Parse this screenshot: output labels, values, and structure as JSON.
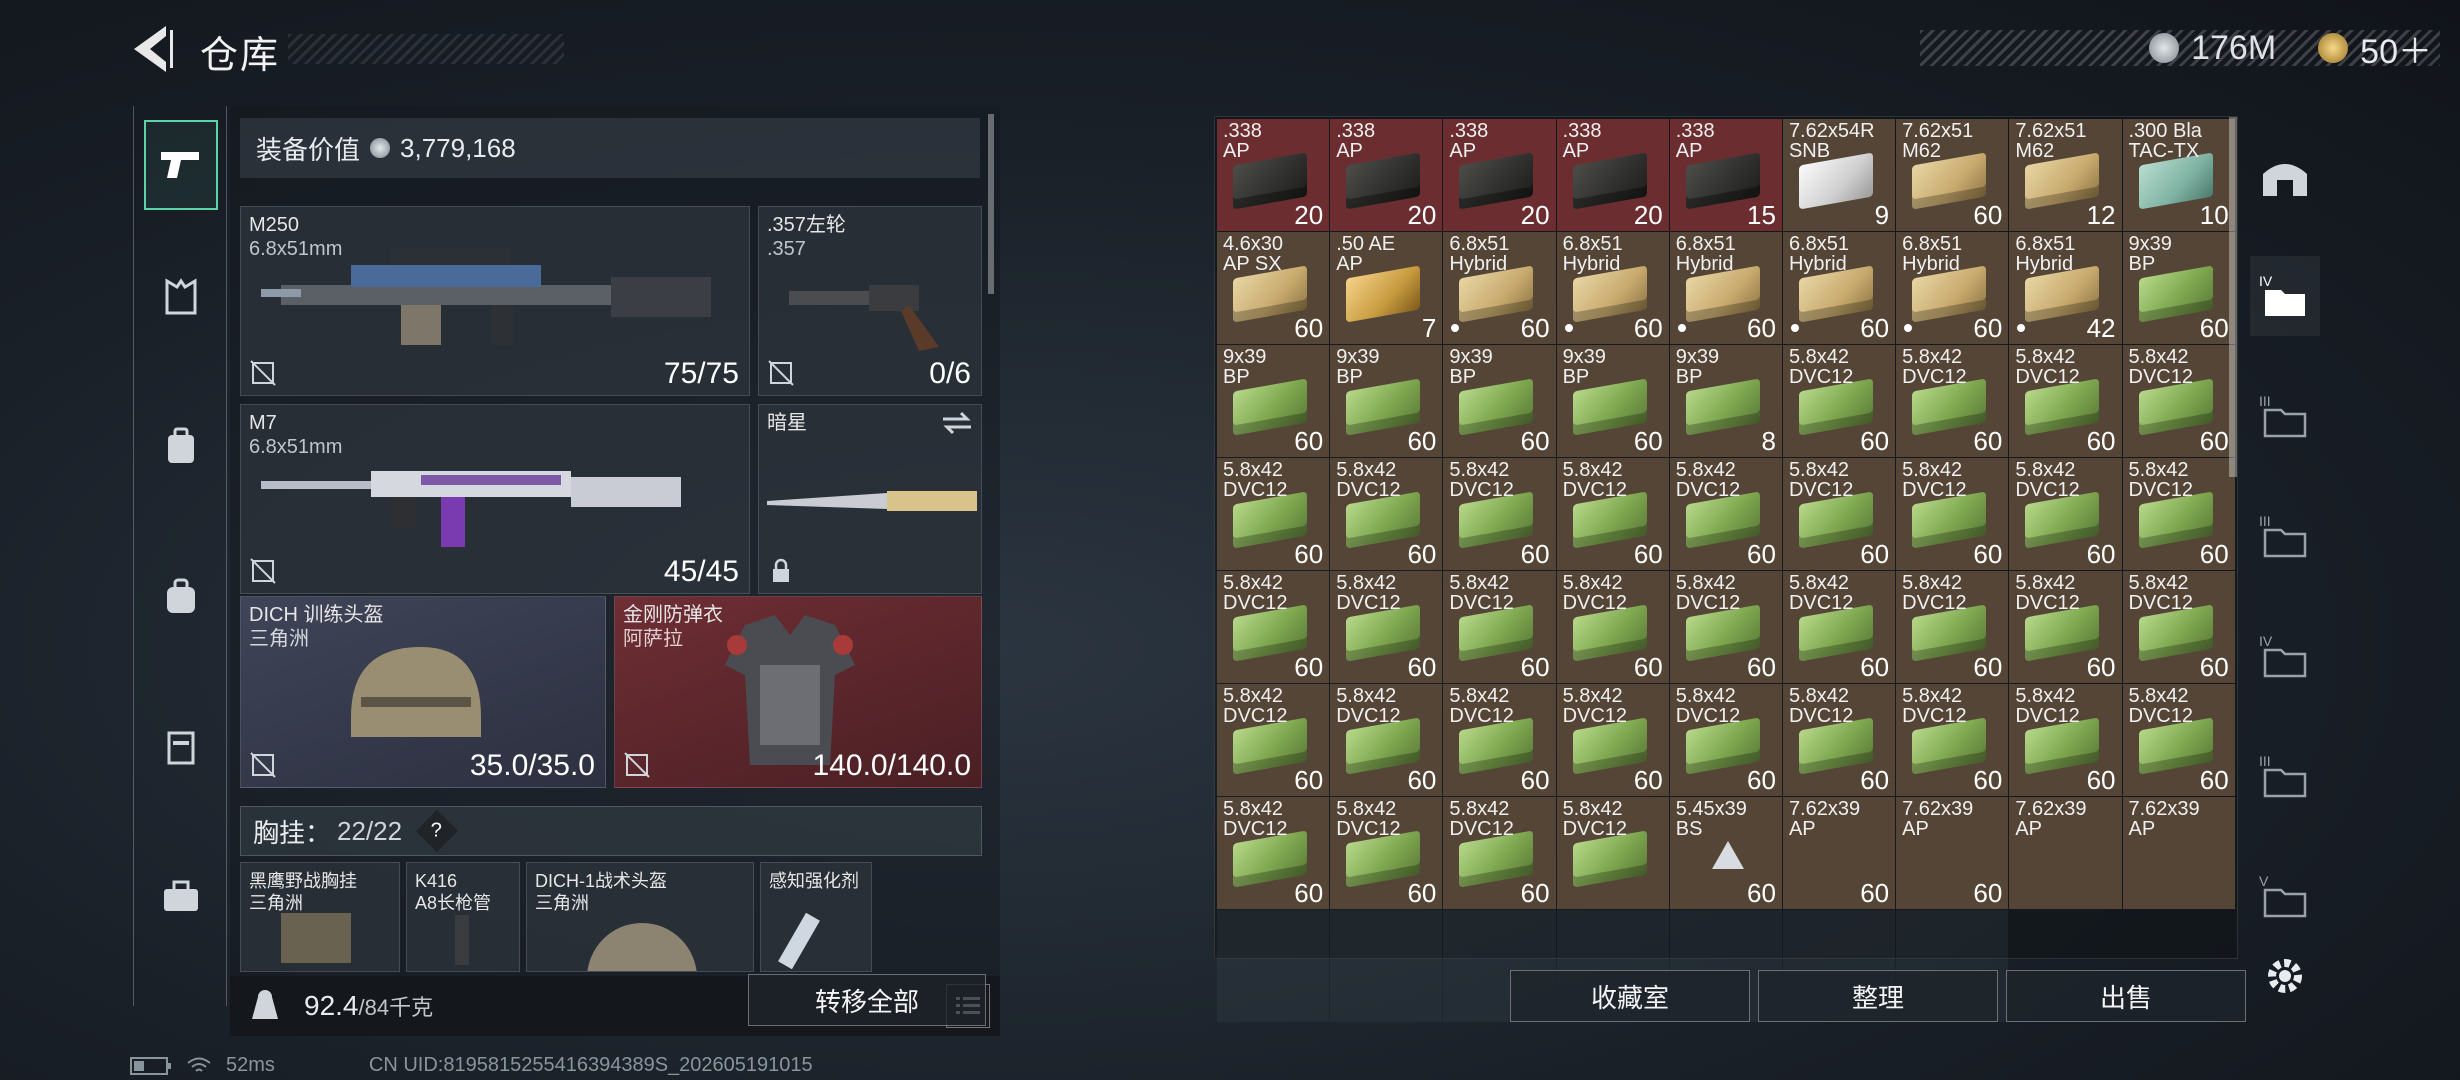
{
  "header": {
    "title": "仓库",
    "currency1": "176M",
    "currency2": "50＋",
    "currency1_color": "#c9cfd6",
    "currency2_color": "#d9b45a"
  },
  "left_nav": {
    "items": [
      {
        "icon": "pistol-icon",
        "active": true
      },
      {
        "icon": "rig-icon"
      },
      {
        "icon": "backpack-icon"
      },
      {
        "icon": "pack-icon"
      },
      {
        "icon": "case-icon"
      },
      {
        "icon": "briefcase-icon"
      }
    ]
  },
  "loadout": {
    "value_label": "装备价值",
    "value": "3,779,168",
    "primary": {
      "name": "M250",
      "caliber": "6.8x51mm",
      "ammo": "75/75"
    },
    "sidearm": {
      "name": ".357左轮",
      "caliber": ".357",
      "ammo": "0/6"
    },
    "secondary": {
      "name": "M7",
      "caliber": "6.8x51mm",
      "ammo": "45/45"
    },
    "melee": {
      "name": "暗星"
    },
    "helmet": {
      "name": "DICH 训练头盔",
      "sub": "三角洲",
      "durability": "35.0/35.0"
    },
    "armor": {
      "name": "金刚防弹衣",
      "sub": "阿萨拉",
      "durability": "140.0/140.0"
    },
    "rig": {
      "label": "胸挂：",
      "count": "22/22",
      "help": "?"
    },
    "rig_items": [
      {
        "l1": "黑鹰野战胸挂",
        "l2": "三角洲"
      },
      {
        "l1": "K416",
        "l2": "A8长枪管"
      },
      {
        "l1": "DICH-1战术头盔",
        "l2": "三角洲"
      },
      {
        "l1": "感知强化剂",
        "l2": ""
      }
    ],
    "weight": "92.4",
    "weight_max": "/84千克",
    "transfer_all": "转移全部"
  },
  "stash": {
    "items": [
      {
        "l1": ".338",
        "l2": "AP",
        "q": "20",
        "c": "dark",
        "bg": "red"
      },
      {
        "l1": ".338",
        "l2": "AP",
        "q": "20",
        "c": "dark",
        "bg": "red"
      },
      {
        "l1": ".338",
        "l2": "AP",
        "q": "20",
        "c": "dark",
        "bg": "red"
      },
      {
        "l1": ".338",
        "l2": "AP",
        "q": "20",
        "c": "dark",
        "bg": "red"
      },
      {
        "l1": ".338",
        "l2": "AP",
        "q": "15",
        "c": "dark",
        "bg": "red"
      },
      {
        "l1": "7.62x54R",
        "l2": "SNB",
        "q": "9",
        "c": "white"
      },
      {
        "l1": "7.62x51",
        "l2": "M62",
        "q": "60",
        "c": "tan"
      },
      {
        "l1": "7.62x51",
        "l2": "M62",
        "q": "12",
        "c": "tan"
      },
      {
        "l1": ".300 Bla",
        "l2": "TAC-TX",
        "q": "10",
        "c": "teal"
      },
      {
        "l1": "4.6x30",
        "l2": "AP SX",
        "q": "60",
        "c": "tan"
      },
      {
        "l1": ".50 AE",
        "l2": "AP",
        "q": "7",
        "c": "gold"
      },
      {
        "l1": "6.8x51",
        "l2": "Hybrid",
        "q": "60",
        "c": "tan",
        "dot": true
      },
      {
        "l1": "6.8x51",
        "l2": "Hybrid",
        "q": "60",
        "c": "tan",
        "dot": true
      },
      {
        "l1": "6.8x51",
        "l2": "Hybrid",
        "q": "60",
        "c": "tan",
        "dot": true
      },
      {
        "l1": "6.8x51",
        "l2": "Hybrid",
        "q": "60",
        "c": "tan",
        "dot": true
      },
      {
        "l1": "6.8x51",
        "l2": "Hybrid",
        "q": "60",
        "c": "tan",
        "dot": true
      },
      {
        "l1": "6.8x51",
        "l2": "Hybrid",
        "q": "42",
        "c": "tan",
        "dot": true
      },
      {
        "l1": "9x39",
        "l2": "BP",
        "q": "60",
        "c": "green"
      },
      {
        "l1": "9x39",
        "l2": "BP",
        "q": "60",
        "c": "green"
      },
      {
        "l1": "9x39",
        "l2": "BP",
        "q": "60",
        "c": "green"
      },
      {
        "l1": "9x39",
        "l2": "BP",
        "q": "60",
        "c": "green"
      },
      {
        "l1": "9x39",
        "l2": "BP",
        "q": "60",
        "c": "green"
      },
      {
        "l1": "9x39",
        "l2": "BP",
        "q": "8",
        "c": "green"
      },
      {
        "l1": "5.8x42",
        "l2": "DVC12",
        "q": "60",
        "c": "green"
      },
      {
        "l1": "5.8x42",
        "l2": "DVC12",
        "q": "60",
        "c": "green"
      },
      {
        "l1": "5.8x42",
        "l2": "DVC12",
        "q": "60",
        "c": "green"
      },
      {
        "l1": "5.8x42",
        "l2": "DVC12",
        "q": "60",
        "c": "green"
      },
      {
        "l1": "5.8x42",
        "l2": "DVC12",
        "q": "60",
        "c": "green"
      },
      {
        "l1": "5.8x42",
        "l2": "DVC12",
        "q": "60",
        "c": "green"
      },
      {
        "l1": "5.8x42",
        "l2": "DVC12",
        "q": "60",
        "c": "green"
      },
      {
        "l1": "5.8x42",
        "l2": "DVC12",
        "q": "60",
        "c": "green"
      },
      {
        "l1": "5.8x42",
        "l2": "DVC12",
        "q": "60",
        "c": "green"
      },
      {
        "l1": "5.8x42",
        "l2": "DVC12",
        "q": "60",
        "c": "green"
      },
      {
        "l1": "5.8x42",
        "l2": "DVC12",
        "q": "60",
        "c": "green"
      },
      {
        "l1": "5.8x42",
        "l2": "DVC12",
        "q": "60",
        "c": "green"
      },
      {
        "l1": "5.8x42",
        "l2": "DVC12",
        "q": "60",
        "c": "green"
      },
      {
        "l1": "5.8x42",
        "l2": "DVC12",
        "q": "60",
        "c": "green"
      },
      {
        "l1": "5.8x42",
        "l2": "DVC12",
        "q": "60",
        "c": "green"
      },
      {
        "l1": "5.8x42",
        "l2": "DVC12",
        "q": "60",
        "c": "green"
      },
      {
        "l1": "5.8x42",
        "l2": "DVC12",
        "q": "60",
        "c": "green"
      },
      {
        "l1": "5.8x42",
        "l2": "DVC12",
        "q": "60",
        "c": "green"
      },
      {
        "l1": "5.8x42",
        "l2": "DVC12",
        "q": "60",
        "c": "green"
      },
      {
        "l1": "5.8x42",
        "l2": "DVC12",
        "q": "60",
        "c": "green"
      },
      {
        "l1": "5.8x42",
        "l2": "DVC12",
        "q": "60",
        "c": "green"
      },
      {
        "l1": "5.8x42",
        "l2": "DVC12",
        "q": "60",
        "c": "green"
      },
      {
        "l1": "5.8x42",
        "l2": "DVC12",
        "q": "60",
        "c": "green"
      },
      {
        "l1": "5.8x42",
        "l2": "DVC12",
        "q": "60",
        "c": "green"
      },
      {
        "l1": "5.8x42",
        "l2": "DVC12",
        "q": "60",
        "c": "green"
      },
      {
        "l1": "5.8x42",
        "l2": "DVC12",
        "q": "60",
        "c": "green"
      },
      {
        "l1": "5.8x42",
        "l2": "DVC12",
        "q": "60",
        "c": "green"
      },
      {
        "l1": "5.8x42",
        "l2": "DVC12",
        "q": "60",
        "c": "green"
      },
      {
        "l1": "5.8x42",
        "l2": "DVC12",
        "q": "60",
        "c": "green"
      },
      {
        "l1": "5.8x42",
        "l2": "DVC12",
        "q": "60",
        "c": "green"
      },
      {
        "l1": "5.8x42",
        "l2": "DVC12",
        "q": "60",
        "c": "green"
      },
      {
        "l1": "5.8x42",
        "l2": "DVC12",
        "q": "60",
        "c": "green"
      },
      {
        "l1": "5.8x42",
        "l2": "DVC12",
        "q": "60",
        "c": "green"
      },
      {
        "l1": "5.8x42",
        "l2": "DVC12",
        "q": "60",
        "c": "green"
      },
      {
        "l1": "5.8x42",
        "l2": "DVC12",
        "q": "",
        "c": "green"
      },
      {
        "l1": "5.45x39",
        "l2": "BS",
        "q": "60",
        "c": "none",
        "tri": true
      },
      {
        "l1": "7.62x39",
        "l2": "AP",
        "q": "60",
        "c": "none"
      },
      {
        "l1": "7.62x39",
        "l2": "AP",
        "q": "60",
        "c": "none"
      },
      {
        "l1": "7.62x39",
        "l2": "AP",
        "q": "",
        "c": "none"
      },
      {
        "l1": "7.62x39",
        "l2": "AP",
        "q": "",
        "c": "none"
      }
    ],
    "empty_slots": 7
  },
  "buttons": {
    "collection": "收藏室",
    "organize": "整理",
    "sell": "出售"
  },
  "status": {
    "ping": "52ms",
    "uid": "CN UID:8195815255416394389S_202605191015"
  }
}
